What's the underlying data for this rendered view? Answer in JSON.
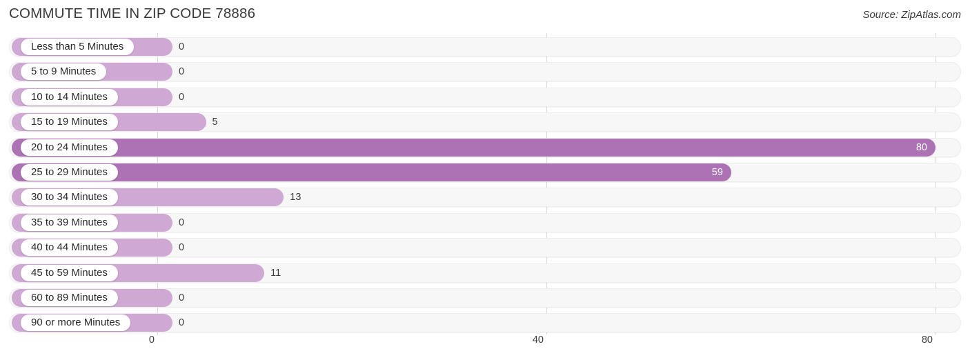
{
  "header": {
    "title": "COMMUTE TIME IN ZIP CODE 78886",
    "source": "Source: ZipAtlas.com"
  },
  "colors": {
    "bar_light": "#cfa8d3",
    "bar_dark": "#ac72b4",
    "track": "#f7f7f7",
    "gridline": "#d8d8d8",
    "text": "#3a3a3a"
  },
  "chart_data": {
    "type": "bar",
    "orientation": "horizontal",
    "title": "COMMUTE TIME IN ZIP CODE 78886",
    "xlabel": "",
    "ylabel": "",
    "xlim": [
      0,
      80
    ],
    "ticks": [
      "0",
      "40",
      "80"
    ],
    "tick_values": [
      0,
      40,
      80
    ],
    "grid": true,
    "legend": null,
    "categories": [
      "Less than 5 Minutes",
      "5 to 9 Minutes",
      "10 to 14 Minutes",
      "15 to 19 Minutes",
      "20 to 24 Minutes",
      "25 to 29 Minutes",
      "30 to 34 Minutes",
      "35 to 39 Minutes",
      "40 to 44 Minutes",
      "45 to 59 Minutes",
      "60 to 89 Minutes",
      "90 or more Minutes"
    ],
    "values": [
      0,
      0,
      0,
      5,
      80,
      59,
      13,
      0,
      0,
      11,
      0,
      0
    ],
    "value_labels": [
      "0",
      "0",
      "0",
      "5",
      "80",
      "59",
      "13",
      "0",
      "0",
      "11",
      "0",
      "0"
    ]
  },
  "rows": [
    {
      "label": "Less than 5 Minutes",
      "value": 0,
      "value_label": "0",
      "style": "light",
      "inside": false
    },
    {
      "label": "5 to 9 Minutes",
      "value": 0,
      "value_label": "0",
      "style": "light",
      "inside": false
    },
    {
      "label": "10 to 14 Minutes",
      "value": 0,
      "value_label": "0",
      "style": "light",
      "inside": false
    },
    {
      "label": "15 to 19 Minutes",
      "value": 5,
      "value_label": "5",
      "style": "light",
      "inside": false
    },
    {
      "label": "20 to 24 Minutes",
      "value": 80,
      "value_label": "80",
      "style": "dark",
      "inside": true
    },
    {
      "label": "25 to 29 Minutes",
      "value": 59,
      "value_label": "59",
      "style": "dark",
      "inside": true
    },
    {
      "label": "30 to 34 Minutes",
      "value": 13,
      "value_label": "13",
      "style": "light",
      "inside": false
    },
    {
      "label": "35 to 39 Minutes",
      "value": 0,
      "value_label": "0",
      "style": "light",
      "inside": false
    },
    {
      "label": "40 to 44 Minutes",
      "value": 0,
      "value_label": "0",
      "style": "light",
      "inside": false
    },
    {
      "label": "45 to 59 Minutes",
      "value": 11,
      "value_label": "11",
      "style": "light",
      "inside": false
    },
    {
      "label": "60 to 89 Minutes",
      "value": 0,
      "value_label": "0",
      "style": "light",
      "inside": false
    },
    {
      "label": "90 or more Minutes",
      "value": 0,
      "value_label": "0",
      "style": "light",
      "inside": false
    }
  ],
  "axis": {
    "ticks": [
      {
        "label": "0",
        "value": 0
      },
      {
        "label": "40",
        "value": 40
      },
      {
        "label": "80",
        "value": 80
      }
    ]
  }
}
